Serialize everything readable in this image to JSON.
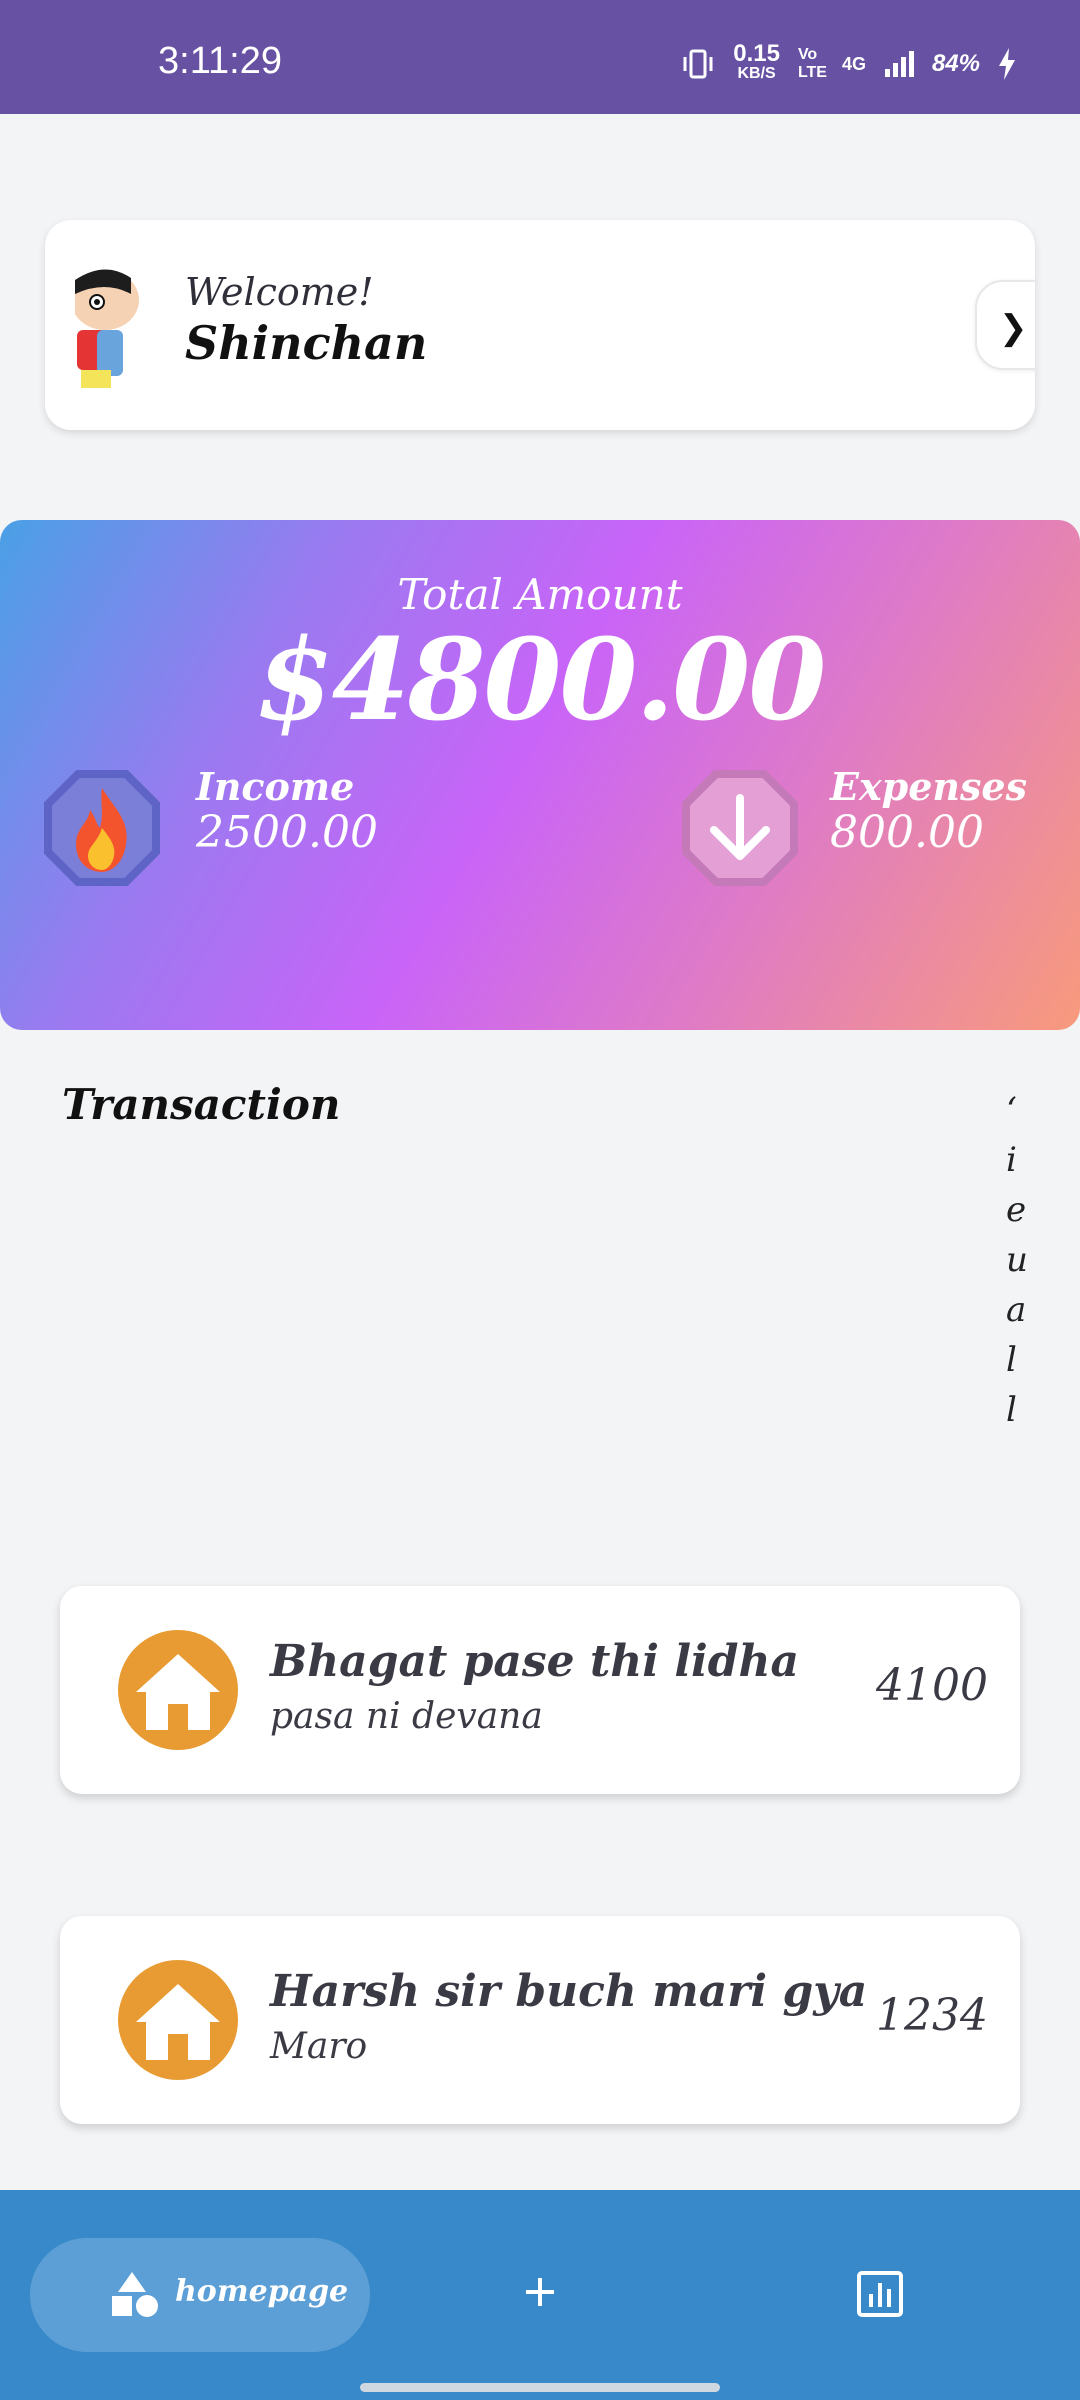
{
  "status_bar": {
    "time": "3:11:29",
    "net_speed": "0.15",
    "net_unit": "KB/S",
    "volte": "Vo LTE",
    "network": "4G",
    "battery": "84%"
  },
  "welcome": {
    "greeting": "Welcome!",
    "name": "Shinchan",
    "avatar_icon": "shinchan-avatar"
  },
  "balance": {
    "label": "Total Amount",
    "amount": "$4800.00",
    "income_label": "Income",
    "income_value": "2500.00",
    "income_icon": "fire-icon",
    "expenses_label": "Expenses",
    "expenses_value": "800.00",
    "expenses_icon": "arrow-down-icon"
  },
  "transactions": {
    "title": "Transaction",
    "side_glyphs": "‘ i e u  a l l",
    "items": [
      {
        "title": "Bhagat pase thi lidha",
        "subtitle": "pasa ni devana",
        "amount": "4100",
        "icon": "house-icon"
      },
      {
        "title": "Harsh sir buch mari gya",
        "subtitle": "Maro",
        "amount": "1234",
        "icon": "house-icon"
      }
    ]
  },
  "nav": {
    "home_label": "homepage",
    "home_icon": "shapes-icon",
    "add_icon": "plus-icon",
    "stats_icon": "bar-chart-icon"
  },
  "colors": {
    "status_bar": "#6751a3",
    "nav": "#3889c9",
    "house_icon": "#e89b32",
    "card_gradient_start": "#4aa0e6",
    "card_gradient_mid": "#c964f8",
    "card_gradient_end": "#f89a7c"
  }
}
